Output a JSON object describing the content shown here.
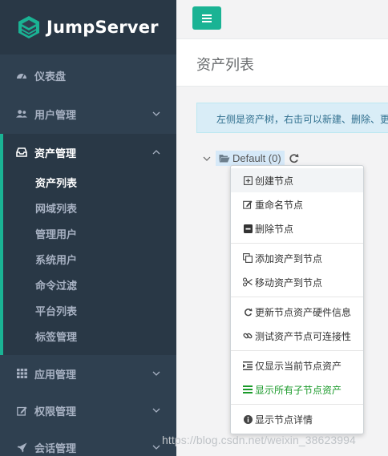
{
  "brand": {
    "name": "JumpServer",
    "color": "#1ab394"
  },
  "sidebar": {
    "items": [
      {
        "label": "仪表盘",
        "icon": "dashboard-icon"
      },
      {
        "label": "用户管理",
        "icon": "users-icon"
      },
      {
        "label": "资产管理",
        "icon": "inbox-icon"
      },
      {
        "label": "应用管理",
        "icon": "grid-icon"
      },
      {
        "label": "权限管理",
        "icon": "edit-icon"
      },
      {
        "label": "会话管理",
        "icon": "rocket-icon"
      }
    ],
    "submenu": [
      {
        "label": "资产列表"
      },
      {
        "label": "网域列表"
      },
      {
        "label": "管理用户"
      },
      {
        "label": "系统用户"
      },
      {
        "label": "命令过滤"
      },
      {
        "label": "平台列表"
      },
      {
        "label": "标签管理"
      }
    ]
  },
  "page": {
    "title": "资产列表",
    "alert": "左侧是资产树，右击可以新建、删除、更"
  },
  "tree": {
    "root_label": "Default (0)"
  },
  "context_menu": {
    "items": [
      {
        "label": "创建节点",
        "icon": "plus-square-icon"
      },
      {
        "label": "重命名节点",
        "icon": "edit-icon"
      },
      {
        "label": "删除节点",
        "icon": "minus-square-icon"
      },
      {
        "label": "添加资产到节点",
        "icon": "copy-icon"
      },
      {
        "label": "移动资产到节点",
        "icon": "scissors-icon"
      },
      {
        "label": "更新节点资产硬件信息",
        "icon": "refresh-icon"
      },
      {
        "label": "测试资产节点可连接性",
        "icon": "link-icon"
      },
      {
        "label": "仅显示当前节点资产",
        "icon": "indent-icon"
      },
      {
        "label": "显示所有子节点资产",
        "icon": "list-icon"
      },
      {
        "label": "显示节点详情",
        "icon": "info-circle-icon"
      }
    ]
  },
  "watermark": "https://blog.csdn.net/weixin_38623994"
}
